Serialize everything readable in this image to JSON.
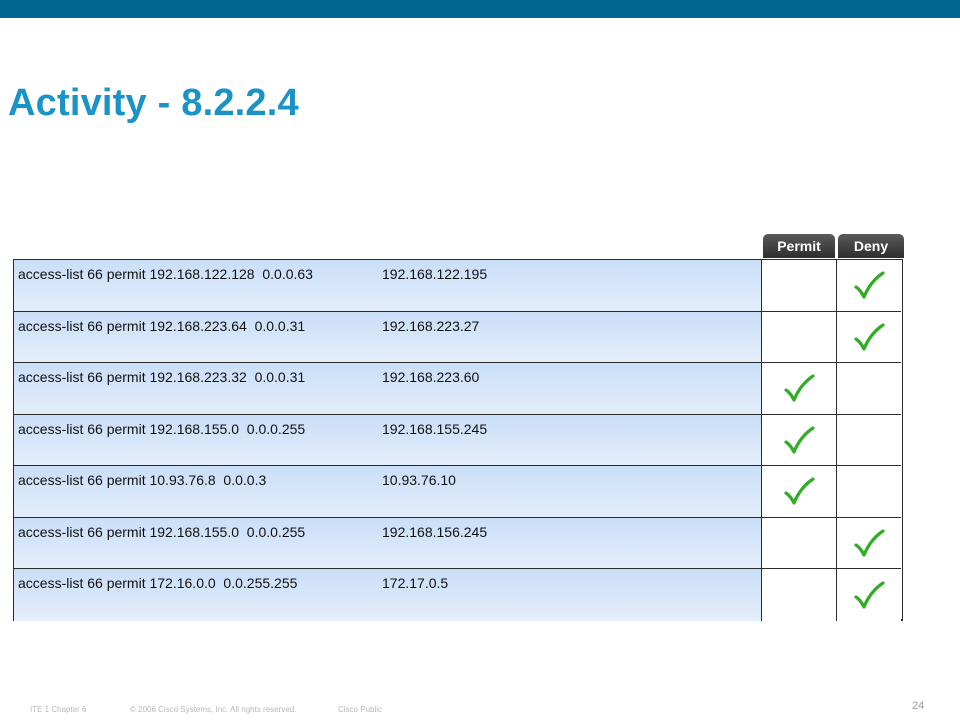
{
  "slide": {
    "title": "Activity - 8.2.2.4",
    "accent_color": "#00678f",
    "title_color": "#1a93c6"
  },
  "table": {
    "headers": {
      "permit": "Permit",
      "deny": "Deny"
    },
    "rows": [
      {
        "acl": "access-list 66 permit 192.168.122.128  0.0.0.63",
        "address": "192.168.122.195",
        "result": "deny"
      },
      {
        "acl": "access-list 66 permit 192.168.223.64  0.0.0.31",
        "address": "192.168.223.27",
        "result": "deny"
      },
      {
        "acl": "access-list 66 permit 192.168.223.32  0.0.0.31",
        "address": "192.168.223.60",
        "result": "permit"
      },
      {
        "acl": "access-list 66 permit 192.168.155.0  0.0.0.255",
        "address": "192.168.155.245",
        "result": "permit"
      },
      {
        "acl": "access-list 66 permit 10.93.76.8  0.0.0.3",
        "address": "10.93.76.10",
        "result": "permit"
      },
      {
        "acl": "access-list 66 permit 192.168.155.0  0.0.0.255",
        "address": "192.168.156.245",
        "result": "deny"
      },
      {
        "acl": "access-list 66 permit 172.16.0.0  0.0.255.255",
        "address": "172.17.0.5",
        "result": "deny"
      }
    ],
    "check_icon": "check-mark-icon",
    "check_color": "#2fae24"
  },
  "footer": {
    "chapter": "ITE 1 Chapter 6",
    "copyright": "© 2006 Cisco Systems, Inc. All rights reserved.",
    "classification": "Cisco Public",
    "page_number": "24"
  }
}
